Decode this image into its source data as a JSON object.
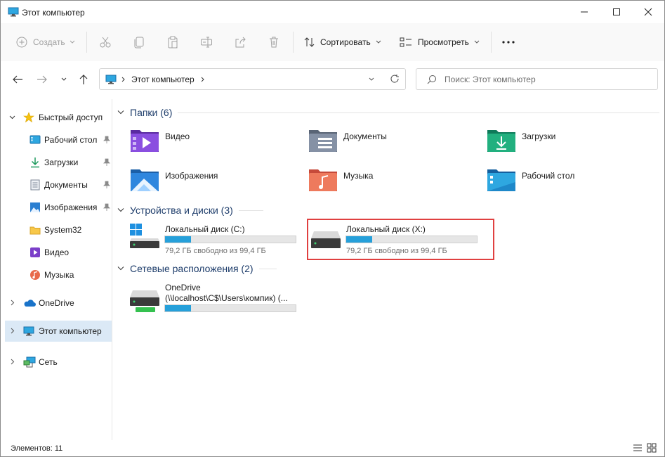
{
  "window": {
    "title": "Этот компьютер"
  },
  "toolbar": {
    "new_label": "Создать",
    "sort_label": "Сортировать",
    "view_label": "Просмотреть"
  },
  "address": {
    "path": "Этот компьютер"
  },
  "search": {
    "placeholder": "Поиск: Этот компьютер"
  },
  "sidebar": {
    "quick_access": "Быстрый доступ",
    "quick_items": [
      {
        "label": "Рабочий стол",
        "icon": "desktop-icon",
        "pinned": true
      },
      {
        "label": "Загрузки",
        "icon": "download-icon",
        "pinned": true
      },
      {
        "label": "Документы",
        "icon": "documents-icon",
        "pinned": true
      },
      {
        "label": "Изображения",
        "icon": "pictures-icon",
        "pinned": true
      },
      {
        "label": "System32",
        "icon": "folder-icon",
        "pinned": false
      },
      {
        "label": "Видео",
        "icon": "video-icon",
        "pinned": false
      },
      {
        "label": "Музыка",
        "icon": "music-icon",
        "pinned": false
      }
    ],
    "onedrive": "OneDrive",
    "this_pc": "Этот компьютер",
    "network": "Сеть"
  },
  "sections": {
    "folders": "Папки (6)",
    "devices": "Устройства и диски (3)",
    "network": "Сетевые расположения (2)"
  },
  "folders": [
    {
      "label": "Видео"
    },
    {
      "label": "Документы"
    },
    {
      "label": "Загрузки"
    },
    {
      "label": "Изображения"
    },
    {
      "label": "Музыка"
    },
    {
      "label": "Рабочий стол"
    }
  ],
  "drives": [
    {
      "label": "Локальный диск (C:)",
      "free": "79,2 ГБ свободно из 99,4 ГБ",
      "used_fraction": 0.2
    },
    {
      "label": "Локальный диск (X:)",
      "free": "79,2 ГБ свободно из 99,4 ГБ",
      "used_fraction": 0.2
    }
  ],
  "network_locations": [
    {
      "label_line1": "OneDrive",
      "label_line2": "(\\\\localhost\\C$\\Users\\компик) (...",
      "used_fraction": 0.2
    }
  ],
  "status": {
    "items": "Элементов: 11"
  },
  "colors": {
    "accent": "#26a0da",
    "highlight": "#e04040",
    "selection": "#dbe9f6"
  }
}
